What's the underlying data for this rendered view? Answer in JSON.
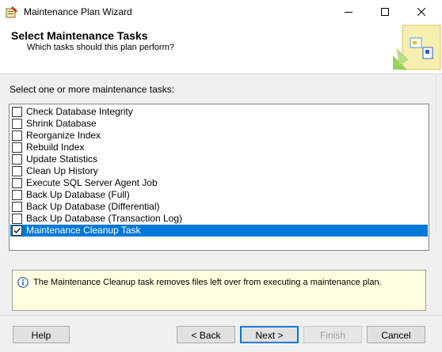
{
  "window": {
    "title": "Maintenance Plan Wizard",
    "controls": [
      "minimize",
      "maximize",
      "close"
    ]
  },
  "header": {
    "title": "Select Maintenance Tasks",
    "subtitle": "Which tasks should this plan perform?"
  },
  "tasks": {
    "label": "Select one or more maintenance tasks:",
    "items": [
      {
        "label": "Check Database Integrity",
        "checked": false,
        "selected": false
      },
      {
        "label": "Shrink Database",
        "checked": false,
        "selected": false
      },
      {
        "label": "Reorganize Index",
        "checked": false,
        "selected": false
      },
      {
        "label": "Rebuild Index",
        "checked": false,
        "selected": false
      },
      {
        "label": "Update Statistics",
        "checked": false,
        "selected": false
      },
      {
        "label": "Clean Up History",
        "checked": false,
        "selected": false
      },
      {
        "label": "Execute SQL Server Agent Job",
        "checked": false,
        "selected": false
      },
      {
        "label": "Back Up Database (Full)",
        "checked": false,
        "selected": false
      },
      {
        "label": "Back Up Database (Differential)",
        "checked": false,
        "selected": false
      },
      {
        "label": "Back Up Database (Transaction Log)",
        "checked": false,
        "selected": false
      },
      {
        "label": "Maintenance Cleanup Task",
        "checked": true,
        "selected": true
      }
    ]
  },
  "description": {
    "icon": "info-icon",
    "text": "The Maintenance Cleanup task removes files left over from executing a maintenance plan."
  },
  "buttons": {
    "help": "Help",
    "back": "< Back",
    "next": "Next >",
    "finish": "Finish",
    "cancel": "Cancel"
  },
  "colors": {
    "selection": "#0078d7",
    "info_background": "#ffffe1"
  }
}
